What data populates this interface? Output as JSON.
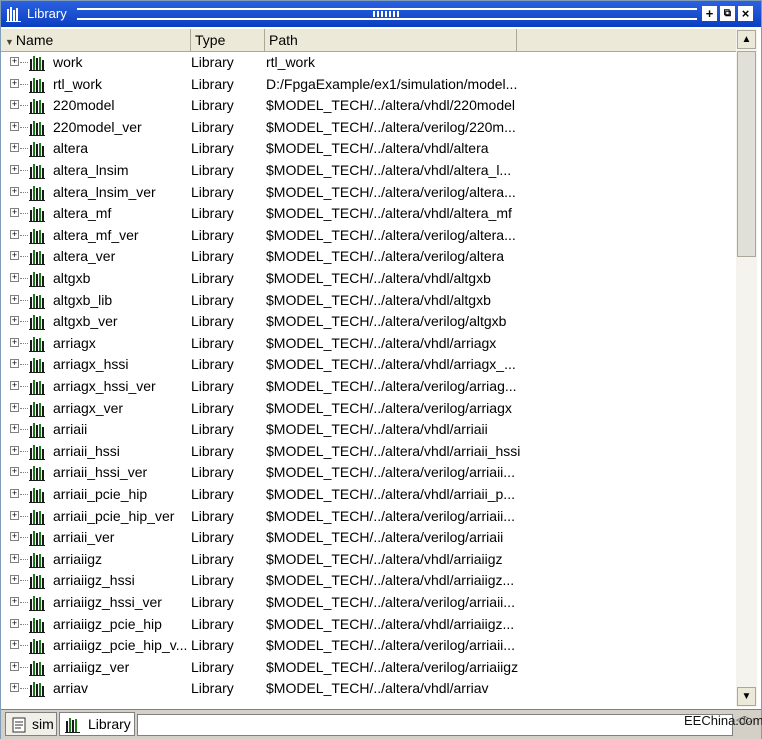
{
  "window": {
    "title": "Library"
  },
  "columns": {
    "name": "Name",
    "type": "Type",
    "path": "Path"
  },
  "rows": [
    {
      "name": "work",
      "type": "Library",
      "path": "rtl_work"
    },
    {
      "name": "rtl_work",
      "type": "Library",
      "path": "D:/FpgaExample/ex1/simulation/model..."
    },
    {
      "name": "220model",
      "type": "Library",
      "path": "$MODEL_TECH/../altera/vhdl/220model"
    },
    {
      "name": "220model_ver",
      "type": "Library",
      "path": "$MODEL_TECH/../altera/verilog/220m..."
    },
    {
      "name": "altera",
      "type": "Library",
      "path": "$MODEL_TECH/../altera/vhdl/altera"
    },
    {
      "name": "altera_lnsim",
      "type": "Library",
      "path": "$MODEL_TECH/../altera/vhdl/altera_l..."
    },
    {
      "name": "altera_lnsim_ver",
      "type": "Library",
      "path": "$MODEL_TECH/../altera/verilog/altera..."
    },
    {
      "name": "altera_mf",
      "type": "Library",
      "path": "$MODEL_TECH/../altera/vhdl/altera_mf"
    },
    {
      "name": "altera_mf_ver",
      "type": "Library",
      "path": "$MODEL_TECH/../altera/verilog/altera..."
    },
    {
      "name": "altera_ver",
      "type": "Library",
      "path": "$MODEL_TECH/../altera/verilog/altera"
    },
    {
      "name": "altgxb",
      "type": "Library",
      "path": "$MODEL_TECH/../altera/vhdl/altgxb"
    },
    {
      "name": "altgxb_lib",
      "type": "Library",
      "path": "$MODEL_TECH/../altera/vhdl/altgxb"
    },
    {
      "name": "altgxb_ver",
      "type": "Library",
      "path": "$MODEL_TECH/../altera/verilog/altgxb"
    },
    {
      "name": "arriagx",
      "type": "Library",
      "path": "$MODEL_TECH/../altera/vhdl/arriagx"
    },
    {
      "name": "arriagx_hssi",
      "type": "Library",
      "path": "$MODEL_TECH/../altera/vhdl/arriagx_..."
    },
    {
      "name": "arriagx_hssi_ver",
      "type": "Library",
      "path": "$MODEL_TECH/../altera/verilog/arriag..."
    },
    {
      "name": "arriagx_ver",
      "type": "Library",
      "path": "$MODEL_TECH/../altera/verilog/arriagx"
    },
    {
      "name": "arriaii",
      "type": "Library",
      "path": "$MODEL_TECH/../altera/vhdl/arriaii"
    },
    {
      "name": "arriaii_hssi",
      "type": "Library",
      "path": "$MODEL_TECH/../altera/vhdl/arriaii_hssi"
    },
    {
      "name": "arriaii_hssi_ver",
      "type": "Library",
      "path": "$MODEL_TECH/../altera/verilog/arriaii..."
    },
    {
      "name": "arriaii_pcie_hip",
      "type": "Library",
      "path": "$MODEL_TECH/../altera/vhdl/arriaii_p..."
    },
    {
      "name": "arriaii_pcie_hip_ver",
      "type": "Library",
      "path": "$MODEL_TECH/../altera/verilog/arriaii..."
    },
    {
      "name": "arriaii_ver",
      "type": "Library",
      "path": "$MODEL_TECH/../altera/verilog/arriaii"
    },
    {
      "name": "arriaiigz",
      "type": "Library",
      "path": "$MODEL_TECH/../altera/vhdl/arriaiigz"
    },
    {
      "name": "arriaiigz_hssi",
      "type": "Library",
      "path": "$MODEL_TECH/../altera/vhdl/arriaiigz..."
    },
    {
      "name": "arriaiigz_hssi_ver",
      "type": "Library",
      "path": "$MODEL_TECH/../altera/verilog/arriaii..."
    },
    {
      "name": "arriaiigz_pcie_hip",
      "type": "Library",
      "path": "$MODEL_TECH/../altera/vhdl/arriaiigz..."
    },
    {
      "name": "arriaiigz_pcie_hip_v...",
      "type": "Library",
      "path": "$MODEL_TECH/../altera/verilog/arriaii..."
    },
    {
      "name": "arriaiigz_ver",
      "type": "Library",
      "path": "$MODEL_TECH/../altera/verilog/arriaiigz"
    },
    {
      "name": "arriav",
      "type": "Library",
      "path": "$MODEL_TECH/../altera/vhdl/arriav"
    }
  ],
  "tabs": [
    {
      "label": "sim",
      "icon": "sim-icon"
    },
    {
      "label": "Library",
      "icon": "library-icon"
    }
  ],
  "watermark": "EEChina.com",
  "colors": {
    "titlebar": "#0b3fc1",
    "header": "#ece9d8",
    "accent_icon": "#1a7a1a"
  }
}
